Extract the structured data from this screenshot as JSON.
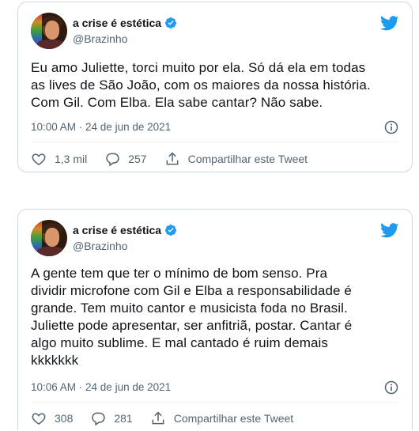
{
  "colors": {
    "twitter_blue": "#1d9bf0",
    "text": "#0f1419",
    "muted": "#536471",
    "border": "#cfd9de"
  },
  "tweets": [
    {
      "display_name": "a crise é estética",
      "handle": "@Brazinho",
      "text": "Eu amo Juliette, torci muito por ela. Só dá ela em todas\nas lives de São João, com os maiores da nossa história.\nCom Gil. Com Elba. Ela sabe cantar? Não sabe.",
      "timestamp": "10:00 AM · 24 de jun de 2021",
      "likes": "1,3 mil",
      "replies": "257",
      "share_label": "Compartilhar este Tweet",
      "icons": [
        "avatar",
        "verified-icon",
        "twitter-bird-icon",
        "info-icon",
        "heart-icon",
        "reply-icon",
        "share-icon"
      ]
    },
    {
      "display_name": "a crise é estética",
      "handle": "@Brazinho",
      "text": "A gente tem que ter o mínimo de bom senso. Pra\ndividir microfone com Gil e Elba a responsabilidade é\ngrande. Tem muito cantor e musicista foda no Brasil.\nJuliette pode apresentar, ser anfitriã, postar. Cantar é\nalgo muito sublime. E mal cantado é ruim demais\nkkkkkkk",
      "timestamp": "10:06 AM · 24 de jun de 2021",
      "likes": "308",
      "replies": "281",
      "share_label": "Compartilhar este Tweet",
      "icons": [
        "avatar",
        "verified-icon",
        "twitter-bird-icon",
        "info-icon",
        "heart-icon",
        "reply-icon",
        "share-icon"
      ]
    }
  ]
}
